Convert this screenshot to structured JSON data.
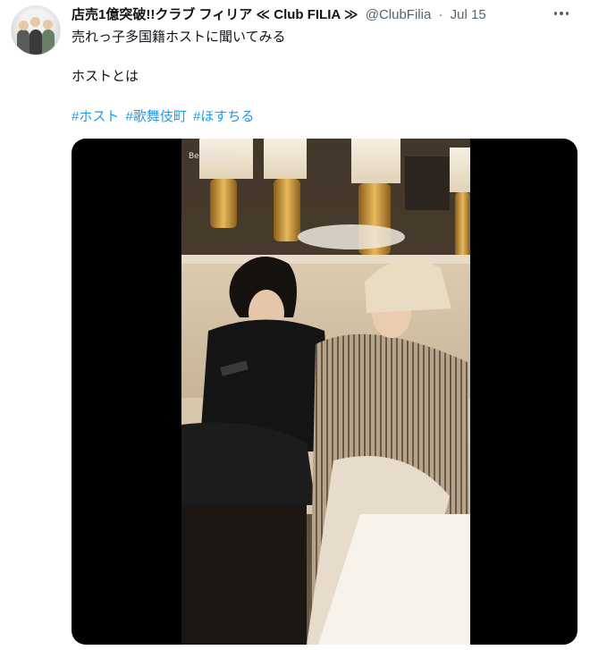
{
  "tweet": {
    "author_name": "店売1億突破!!クラブ フィリア ≪ Club FILIA ≫",
    "handle": "@ClubFilia",
    "separator": "·",
    "date": "Jul 15",
    "line1": "売れっ子多国籍ホストに聞いてみる",
    "line2": "ホストとは",
    "hashtags": [
      "#ホスト",
      "#歌舞伎町",
      "#ほすちる"
    ]
  },
  "media": {
    "watermark": "Bestlin.com"
  },
  "icons": {
    "more": "more-horizontal-icon"
  }
}
